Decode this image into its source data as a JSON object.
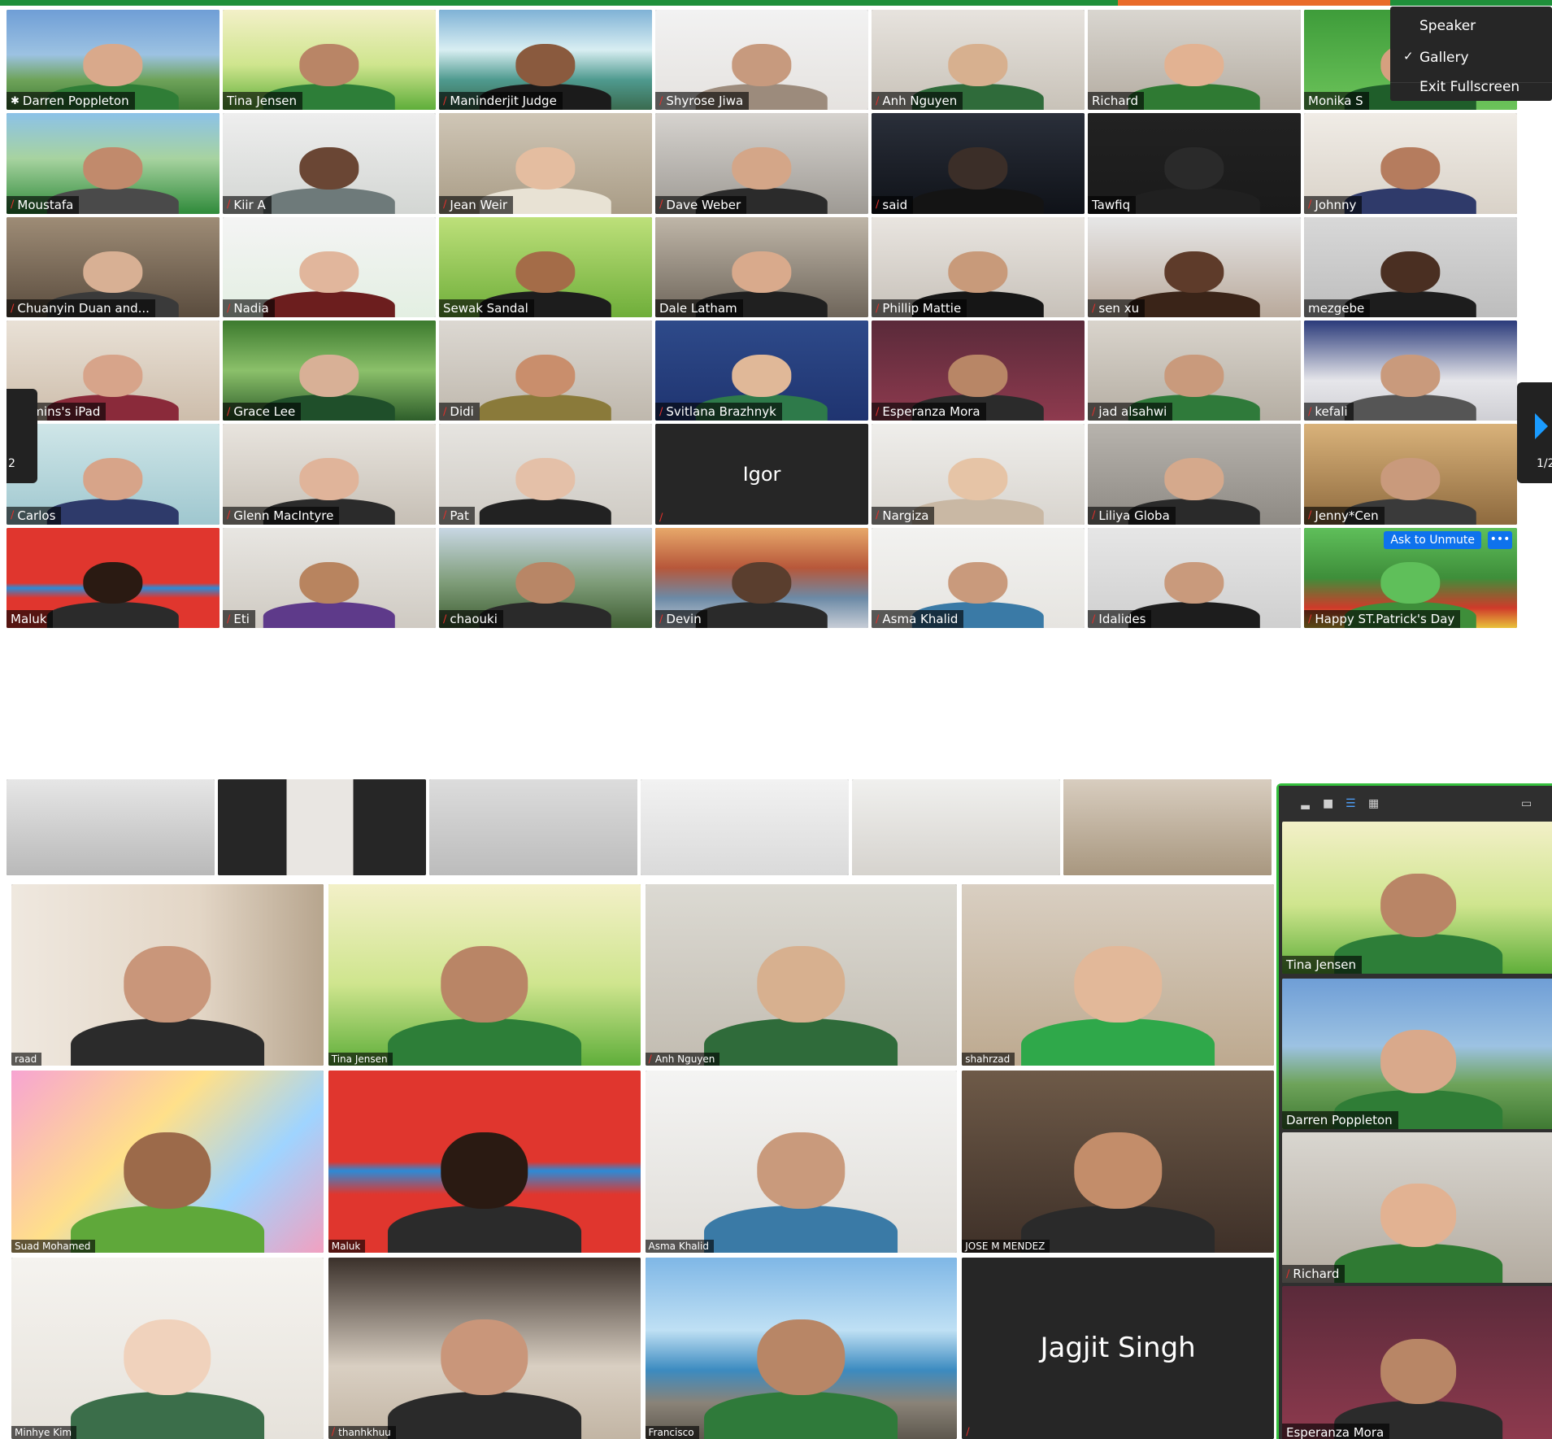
{
  "view_menu": {
    "speaker": "Speaker",
    "gallery": "Gallery",
    "exit_fullscreen": "Exit Fullscreen"
  },
  "page_indicator": {
    "left": "2",
    "right": "1/2"
  },
  "ask_to_unmute": "Ask to Unmute",
  "more_button": "•••",
  "top_gallery": [
    {
      "name": "Darren Poppleton",
      "bg": "linear-gradient(180deg,#6f9ed6 0%,#9cc2e2 45%,#6ea35a 70%,#3f7a33 100%)",
      "skin": "#d9a98b",
      "shirt": "#2f7d36",
      "muted": false,
      "pin": true,
      "active": true
    },
    {
      "name": "Tina Jensen",
      "bg": "linear-gradient(180deg,#f3f0c8 0%,#cfe58e 55%,#5fae3a 100%)",
      "skin": "#b98566",
      "shirt": "#2d7e38",
      "muted": false
    },
    {
      "name": "Maninderjit Judge",
      "bg": "linear-gradient(180deg,#7fb2d6 0%,#d8eef2 40%,#4f9a8f 70%,#3a6b4f 100%)",
      "skin": "#8a5a3e",
      "shirt": "#1b1b1b",
      "muted": true
    },
    {
      "name": "Shyrose Jiwa",
      "bg": "linear-gradient(180deg,#f2f2f2 0%,#e5e2df 100%)",
      "skin": "#c79a7e",
      "shirt": "#9c8b7c",
      "muted": true
    },
    {
      "name": "Anh Nguyen",
      "bg": "linear-gradient(180deg,#e7e3de 0%,#c8c2b8 100%)",
      "skin": "#d7b08f",
      "shirt": "#2f6b3a",
      "muted": true
    },
    {
      "name": "Richard",
      "bg": "linear-gradient(180deg,#d9d6d0 0%,#b4aca1 100%)",
      "skin": "#e2b292",
      "shirt": "#2f7a33",
      "muted": false
    },
    {
      "name": "Monika S",
      "bg": "linear-gradient(180deg,#3e9c3a 0%,#6cc35a 100%)",
      "skin": "#d6a07f",
      "shirt": "#1f5e2a",
      "muted": false
    },
    {
      "name": "Moustafa",
      "bg": "linear-gradient(180deg,#8cc2e8 0%,#a7d3a0 45%,#2f8a3a 100%)",
      "skin": "#c18a6c",
      "shirt": "#4a4a4a",
      "muted": true
    },
    {
      "name": "Kiir A",
      "bg": "linear-gradient(180deg,#eeeeee 0%,#d3d6d3 100%)",
      "skin": "#6a4634",
      "shirt": "#6e7a7a",
      "muted": true
    },
    {
      "name": "Jean Weir",
      "bg": "linear-gradient(180deg,#cfc6b6 0%,#a99c86 100%)",
      "skin": "#e4bda0",
      "shirt": "#e8e2d4",
      "muted": true
    },
    {
      "name": "Dave Weber",
      "bg": "linear-gradient(180deg,#d6d3cf 0%,#9e9a94 100%)",
      "skin": "#d4a688",
      "shirt": "#2b2b2b",
      "muted": true
    },
    {
      "name": "said",
      "bg": "linear-gradient(180deg,#2a2f3a 0%,#0f1218 100%)",
      "skin": "#3b2e28",
      "shirt": "#141414",
      "muted": true
    },
    {
      "name": "Tawfiq",
      "bg": "linear-gradient(180deg,#222222 0%,#1a1a1a 100%)",
      "skin": "#2a2a2a",
      "shirt": "#202020",
      "muted": false
    },
    {
      "name": "Johnny",
      "bg": "linear-gradient(180deg,#f0ece6 0%,#d9d2c8 100%)",
      "skin": "#b57c5e",
      "shirt": "#2f3a6a",
      "muted": true
    },
    {
      "name": "Chuanyin Duan and...",
      "bg": "linear-gradient(180deg,#9e8c76 0%,#5a4c3e 100%)",
      "skin": "#d8b094",
      "shirt": "#3a3a3a",
      "muted": true
    },
    {
      "name": "Nadia",
      "bg": "linear-gradient(180deg,#f4f4f4 0%,#e3efe2 100%)",
      "skin": "#e1b69c",
      "shirt": "#6c1e1e",
      "muted": true
    },
    {
      "name": "Sewak Sandal",
      "bg": "linear-gradient(180deg,#bde07a 0%,#6fae3a 100%)",
      "skin": "#a46c48",
      "shirt": "#1d1d1d",
      "muted": false
    },
    {
      "name": "Dale Latham",
      "bg": "linear-gradient(180deg,#bfb6a8 0%,#6e655a 100%)",
      "skin": "#d9aa8c",
      "shirt": "#202020",
      "muted": false
    },
    {
      "name": "Phillip Mattie",
      "bg": "linear-gradient(180deg,#e9e5e0 0%,#c7c1b9 100%)",
      "skin": "#c89a7a",
      "shirt": "#161616",
      "muted": true
    },
    {
      "name": "sen xu",
      "bg": "linear-gradient(180deg,#e7e7e7 0%,#b9a99b 100%)",
      "skin": "#5e3b2a",
      "shirt": "#3a2418",
      "muted": true
    },
    {
      "name": "mezgebe",
      "bg": "linear-gradient(180deg,#d8d8d8 0%,#bdbdbd 100%)",
      "skin": "#4a2f22",
      "shirt": "#1d1d1d",
      "muted": false
    },
    {
      "name": "Narmins's iPad",
      "bg": "linear-gradient(180deg,#e9e1d6 0%,#cdbdab 100%)",
      "skin": "#d7a48a",
      "shirt": "#8a2a3a",
      "muted": false
    },
    {
      "name": "Grace Lee",
      "bg": "linear-gradient(180deg,#3c7a2e 0%,#8bc06a 50%,#2e5e2a 100%)",
      "skin": "#d8b096",
      "shirt": "#1f4f2a",
      "muted": true
    },
    {
      "name": "Didi",
      "bg": "linear-gradient(180deg,#dcd8d2 0%,#bfb8ad 100%)",
      "skin": "#c98e6c",
      "shirt": "#8a7a3a",
      "muted": true
    },
    {
      "name": "Svitlana Brazhnyk",
      "bg": "linear-gradient(180deg,#2e4a8a 0%,#1f3470 100%)",
      "skin": "#e0b898",
      "shirt": "#2e7a4a",
      "muted": true
    },
    {
      "name": "Esperanza Mora",
      "bg": "linear-gradient(180deg,#5a2a3a 0%,#8e3a4e 100%)",
      "skin": "#b88666",
      "shirt": "#2b2b2b",
      "muted": true
    },
    {
      "name": "jad alsahwi",
      "bg": "linear-gradient(180deg,#d9d4cc 0%,#b5aea3 100%)",
      "skin": "#c99a7c",
      "shirt": "#2f7a3a",
      "muted": true
    },
    {
      "name": "kefali",
      "bg": "linear-gradient(180deg,#2a3a7a 0%,#e6e6ea 60%,#cfcfd4 100%)",
      "skin": "#c99a7c",
      "shirt": "#555555",
      "muted": true
    },
    {
      "name": "Carlos",
      "bg": "linear-gradient(180deg,#cfe6e8 0%,#9fc7cf 100%)",
      "skin": "#d7a489",
      "shirt": "#2e3a6a",
      "muted": true
    },
    {
      "name": "Glenn MacIntyre",
      "bg": "linear-gradient(180deg,#e8e4de 0%,#c6bfb5 100%)",
      "skin": "#e0b49a",
      "shirt": "#2b2b2b",
      "muted": true
    },
    {
      "name": "Pat",
      "bg": "linear-gradient(180deg,#e6e4e0 0%,#cfcbc4 100%)",
      "skin": "#e4c0a8",
      "shirt": "#222222",
      "muted": true
    },
    {
      "name": "Igor",
      "bg": "#262626",
      "muted": true,
      "no_video": true
    },
    {
      "name": "Nargiza",
      "bg": "linear-gradient(180deg,#efeeeb 0%,#d8d4ce 100%)",
      "skin": "#e6c4a6",
      "shirt": "#c9b8a4",
      "muted": true
    },
    {
      "name": "Liliya Globa",
      "bg": "linear-gradient(180deg,#b7b3ad 0%,#8e8a84 100%)",
      "skin": "#d5a98c",
      "shirt": "#2a2a2a",
      "muted": true
    },
    {
      "name": "Jenny*Cen",
      "bg": "linear-gradient(180deg,#d9b27a 0%,#8e6a3e 100%)",
      "skin": "#c99a7c",
      "shirt": "#3a3a3a",
      "muted": true
    },
    {
      "name": "Maluk",
      "bg": "linear-gradient(180deg,#e0362e 0%,#e0362e 55%,#2d8ad6 60%,#e0362e 70%)",
      "skin": "#2a1a12",
      "shirt": "#2b2b2b",
      "muted": false
    },
    {
      "name": "Eti",
      "bg": "linear-gradient(180deg,#e8e6e2 0%,#cfcac2 100%)",
      "skin": "#b8845f",
      "shirt": "#5e3a8a",
      "muted": true
    },
    {
      "name": "chaouki",
      "bg": "linear-gradient(180deg,#c8d7e4 0%,#7e9c78 55%,#3f5e33 100%)",
      "skin": "#b88666",
      "shirt": "#2a2a2a",
      "muted": true
    },
    {
      "name": "Devin",
      "bg": "linear-gradient(180deg,#e7a86a 0%,#b7573a 40%,#6c8aa6 70%,#c7cdd6 100%)",
      "skin": "#5a3e2e",
      "shirt": "#2a2a2a",
      "muted": true
    },
    {
      "name": "Asma Khalid",
      "bg": "linear-gradient(180deg,#f2f2f0 0%,#e6e4e0 100%)",
      "skin": "#c99a7c",
      "shirt": "#3a7aa6",
      "muted": true
    },
    {
      "name": "Idalides",
      "bg": "linear-gradient(180deg,#e6e6e6 0%,#cfcfcf 100%)",
      "skin": "#c99a7c",
      "shirt": "#1d1d1d",
      "muted": true
    },
    {
      "name": "Happy ST.Patrick's Day",
      "bg": "linear-gradient(180deg,#5fbf5a 0%,#3e8e3a 50%,#d03a2a 80%,#e8c23a 100%)",
      "skin": "#5fbf5a",
      "shirt": "#3e8e3a",
      "muted": true,
      "ask_unmute": true
    }
  ],
  "partial_row": [
    {
      "bg": "linear-gradient(180deg,#e6e6e6 0%,#b9b9b9 100%)"
    },
    {
      "bg": "linear-gradient(90deg,#262626 0%,#262626 33%,#e9e6e2 33%,#e9e6e2 65%,#262626 65%)"
    },
    {
      "bg": "linear-gradient(180deg,#dcdcdc 0%,#bcbcbc 100%)"
    },
    {
      "bg": "linear-gradient(180deg,#f2f2f2 0%,#dadada 100%)"
    },
    {
      "bg": "linear-gradient(180deg,#f0f0ee 0%,#d6d3ce 100%)"
    },
    {
      "bg": "linear-gradient(180deg,#d8cdbf 0%,#a8977f 100%)"
    }
  ],
  "bottom_gallery": [
    {
      "name": "raad",
      "bg": "linear-gradient(90deg,#efe8df 0%,#e3d6c6 60%,#b7a58e 100%)",
      "skin": "#c9967a",
      "shirt": "#2b2b2b",
      "muted": false
    },
    {
      "name": "Tina Jensen",
      "bg": "linear-gradient(180deg,#f3f0c8 0%,#cfe58e 55%,#5fae3a 100%)",
      "skin": "#b98566",
      "shirt": "#2d7e38",
      "muted": false,
      "active": true
    },
    {
      "name": "Anh Nguyen",
      "bg": "linear-gradient(180deg,#dcdad3 0%,#c2bcb1 100%)",
      "skin": "#d7b08f",
      "shirt": "#2f6b3a",
      "muted": true
    },
    {
      "name": "shahrzad",
      "bg": "linear-gradient(180deg,#d9cfc2 0%,#bda98f 100%)",
      "skin": "#e2b899",
      "shirt": "#2fa84a",
      "muted": false
    },
    {
      "name": "Suad Mohamed",
      "bg": "linear-gradient(135deg,#f7a4d2 0%,#ffe08a 40%,#9fd4ff 70%,#f2a0c0 100%)",
      "skin": "#9c6a4a",
      "shirt": "#5fa83a",
      "muted": false
    },
    {
      "name": "Maluk",
      "bg": "linear-gradient(180deg,#e0362e 0%,#e0362e 50%,#2d8ad6 55%,#e0362e 68%)",
      "skin": "#2a1a12",
      "shirt": "#2b2b2b",
      "muted": false
    },
    {
      "name": "Asma Khalid",
      "bg": "linear-gradient(180deg,#f4f4f3 0%,#e0ddd8 100%)",
      "skin": "#c99a7c",
      "shirt": "#3a7aa6",
      "muted": false
    },
    {
      "name": "JOSE M MENDEZ",
      "bg": "linear-gradient(180deg,#6e5a48 0%,#3e3028 100%)",
      "skin": "#c38d6a",
      "shirt": "#2a2a2a",
      "muted": false
    },
    {
      "name": "Minhye Kim",
      "bg": "linear-gradient(180deg,#f5f3ef 0%,#e6e2db 100%)",
      "skin": "#f0d2bc",
      "shirt": "#3b6e4a",
      "muted": false
    },
    {
      "name": "thanhkhuu",
      "bg": "linear-gradient(180deg,#3a302a 0%,#d9cfc2 60%,#c2b5a4 100%)",
      "skin": "#c9967a",
      "shirt": "#2a2a2a",
      "muted": true
    },
    {
      "name": "Francisco",
      "bg": "linear-gradient(180deg,#7fb7e6 0%,#bfe0f4 40%,#3c8bc0 62%,#8a8378 80%,#5e584e 100%)",
      "skin": "#b88666",
      "shirt": "#2f7a3a",
      "muted": false
    },
    {
      "name": "Jagjit Singh",
      "bg": "#262626",
      "muted": true,
      "no_video": true
    }
  ],
  "side_panel": [
    {
      "name": "Tina Jensen",
      "bg": "linear-gradient(180deg,#f3f0c8 0%,#cfe58e 55%,#5fae3a 100%)",
      "skin": "#b98566",
      "shirt": "#2d7e38",
      "muted": false
    },
    {
      "name": "Darren Poppleton",
      "bg": "linear-gradient(180deg,#6f9ed6 0%,#9cc2e2 45%,#6ea35a 70%,#3f7a33 100%)",
      "skin": "#d9a98b",
      "shirt": "#2f7d36",
      "muted": false,
      "active": true
    },
    {
      "name": "Richard",
      "bg": "linear-gradient(180deg,#d9d6d0 0%,#b4aca1 100%)",
      "skin": "#e2b292",
      "shirt": "#2f7a33",
      "muted": true
    },
    {
      "name": "Esperanza Mora",
      "bg": "linear-gradient(180deg,#5a2a3a 0%,#8e3a4e 100%)",
      "skin": "#b88666",
      "shirt": "#2b2b2b",
      "muted": false
    }
  ]
}
